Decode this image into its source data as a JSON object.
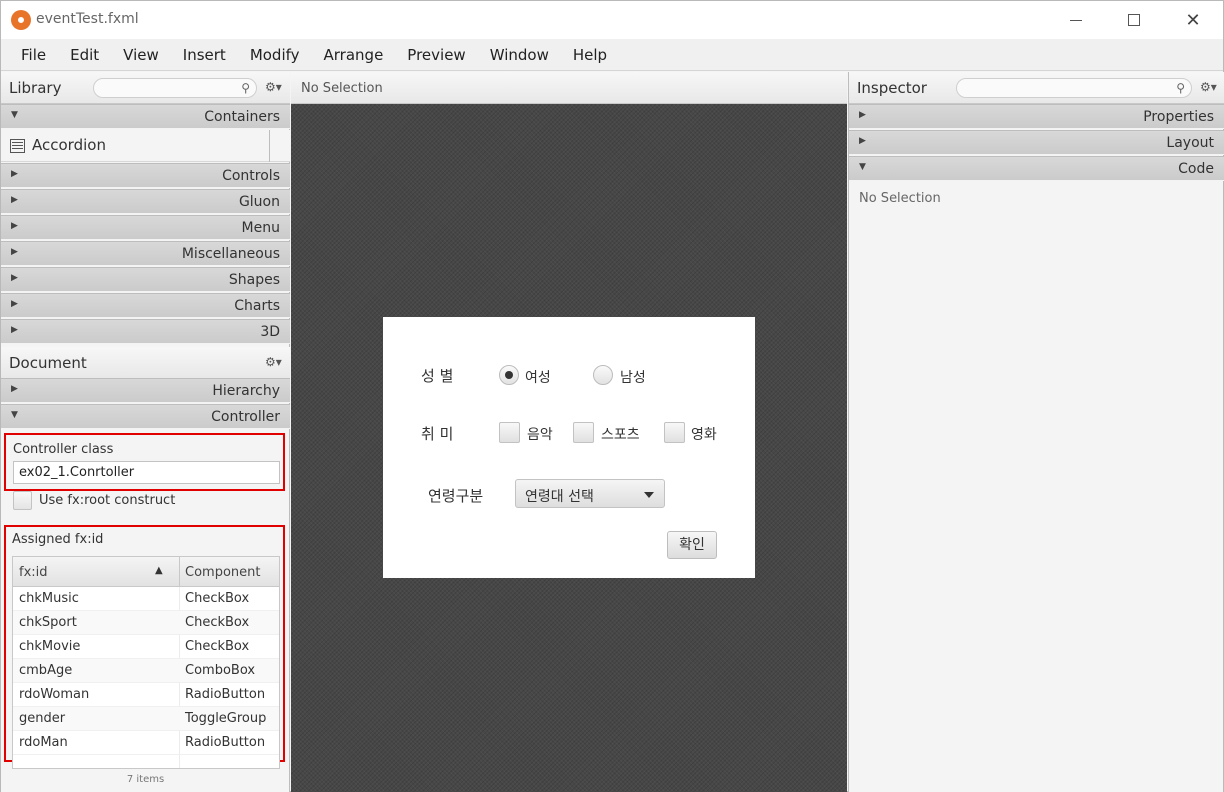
{
  "window": {
    "title": "eventTest.fxml"
  },
  "menubar": {
    "items": [
      "File",
      "Edit",
      "View",
      "Insert",
      "Modify",
      "Arrange",
      "Preview",
      "Window",
      "Help"
    ]
  },
  "library": {
    "title": "Library",
    "sections": [
      {
        "label": "Containers",
        "expanded": true
      },
      {
        "label": "Controls"
      },
      {
        "label": "Gluon"
      },
      {
        "label": "Menu"
      },
      {
        "label": "Miscellaneous"
      },
      {
        "label": "Shapes"
      },
      {
        "label": "Charts"
      },
      {
        "label": "3D"
      }
    ],
    "containers_item": "Accordion"
  },
  "document": {
    "title": "Document",
    "sections": [
      {
        "label": "Hierarchy"
      },
      {
        "label": "Controller",
        "expanded": true
      }
    ],
    "controller_class_label": "Controller class",
    "controller_class_value": "ex02_1.Conrtoller",
    "use_root_label": "Use fx:root construct",
    "assigned_label": "Assigned fx:id",
    "table": {
      "headers": [
        "fx:id",
        "Component"
      ],
      "rows": [
        [
          "chkMusic",
          "CheckBox"
        ],
        [
          "chkSport",
          "CheckBox"
        ],
        [
          "chkMovie",
          "CheckBox"
        ],
        [
          "cmbAge",
          "ComboBox"
        ],
        [
          "rdoWoman",
          "RadioButton"
        ],
        [
          "gender",
          "ToggleGroup"
        ],
        [
          "rdoMan",
          "RadioButton"
        ]
      ],
      "footer": "7 items"
    }
  },
  "center": {
    "status": "No Selection"
  },
  "form": {
    "gender_label": "성 별",
    "female": "여성",
    "male": "남성",
    "hobby_label": "취 미",
    "music": "음악",
    "sports": "스포츠",
    "movie": "영화",
    "age_label": "연령구분",
    "age_combo": "연령대 선택",
    "ok": "확인"
  },
  "inspector": {
    "title": "Inspector",
    "sections": [
      {
        "label": "Properties"
      },
      {
        "label": "Layout"
      },
      {
        "label": "Code",
        "expanded": true
      }
    ],
    "status": "No Selection"
  },
  "colors": {
    "highlight": "#e00000",
    "canvas": "#474747",
    "app_icon": "#e8742a"
  }
}
